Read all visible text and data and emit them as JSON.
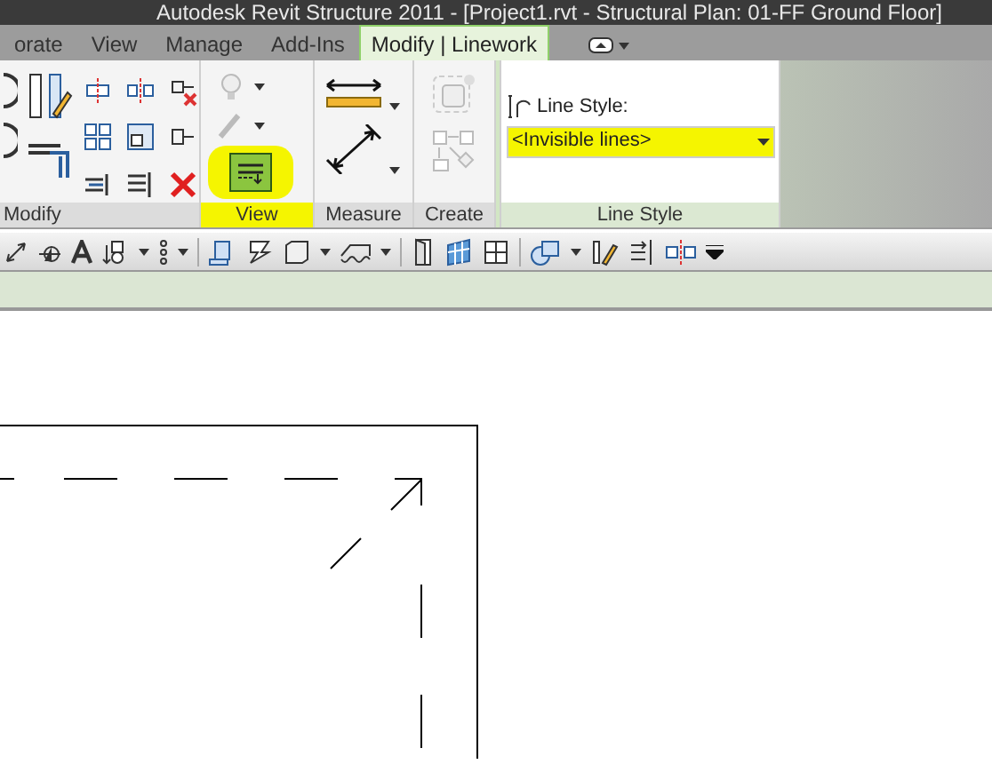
{
  "window": {
    "title": "Autodesk Revit Structure 2011 - [Project1.rvt - Structural Plan: 01-FF Ground Floor]"
  },
  "tabs": [
    {
      "label": "orate",
      "selected": false
    },
    {
      "label": "View",
      "selected": false
    },
    {
      "label": "Manage",
      "selected": false
    },
    {
      "label": "Add-Ins",
      "selected": false
    },
    {
      "label": "Modify | Linework",
      "selected": true
    }
  ],
  "panels": [
    {
      "label": "Modify"
    },
    {
      "label": "View",
      "highlighted": true
    },
    {
      "label": "Measure"
    },
    {
      "label": "Create"
    }
  ],
  "line_style": {
    "label": "Line Style:",
    "value": "<Invisible lines>",
    "highlighted": true,
    "panel_label": "Line Style"
  }
}
